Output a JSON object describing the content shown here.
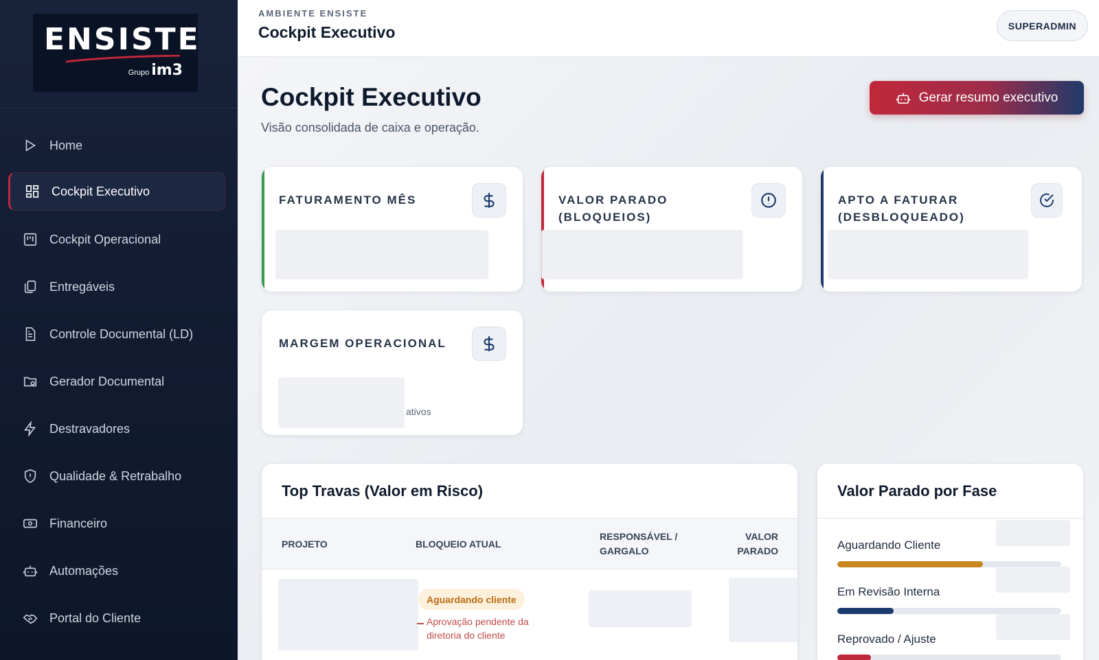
{
  "brand": {
    "name": "ENSISTE",
    "group_label": "Grupo",
    "group_name": "im3"
  },
  "sidebar": {
    "items": [
      {
        "label": "Home",
        "icon": "play-icon",
        "active": false
      },
      {
        "label": "Cockpit Executivo",
        "icon": "grid-icon",
        "active": true
      },
      {
        "label": "Cockpit Operacional",
        "icon": "kanban-icon",
        "active": false
      },
      {
        "label": "Entregáveis",
        "icon": "copy-icon",
        "active": false
      },
      {
        "label": "Controle Documental (LD)",
        "icon": "document-icon",
        "active": false
      },
      {
        "label": "Gerador Documental",
        "icon": "folder-gear-icon",
        "active": false
      },
      {
        "label": "Destravadores",
        "icon": "lightning-icon",
        "active": false
      },
      {
        "label": "Qualidade & Retrabalho",
        "icon": "shield-icon",
        "active": false
      },
      {
        "label": "Financeiro",
        "icon": "banknote-icon",
        "active": false
      },
      {
        "label": "Automações",
        "icon": "robot-icon",
        "active": false
      },
      {
        "label": "Portal do Cliente",
        "icon": "handshake-icon",
        "active": false
      }
    ]
  },
  "header": {
    "eyebrow": "AMBIENTE ENSISTE",
    "title": "Cockpit Executivo",
    "role": "SUPERADMIN"
  },
  "page": {
    "title": "Cockpit Executivo",
    "subtitle": "Visão consolidada de caixa e operação.",
    "action_label": "Gerar resumo executivo"
  },
  "kpis": [
    {
      "label": "FATURAMENTO MÊS",
      "icon": "dollar-icon",
      "accent": "#3a9a4f"
    },
    {
      "label": "VALOR PARADO (BLOQUEIOS)",
      "icon": "alert-circle-icon",
      "accent": "#c0283c"
    },
    {
      "label": "APTO A FATURAR (DESBLOQUEADO)",
      "icon": "check-circle-icon",
      "accent": "#1c3a6b"
    },
    {
      "label": "MARGEM OPERACIONAL",
      "icon": "dollar-icon",
      "accent": null,
      "tail_text": "ativos"
    }
  ],
  "travas": {
    "title": "Top Travas (Valor em Risco)",
    "columns": [
      "PROJETO",
      "BLOQUEIO ATUAL",
      "RESPONSÁVEL / GARGALO",
      "VALOR PARADO"
    ],
    "rows": [
      {
        "bloqueio": "Aguardando cliente",
        "nota": "Aprovação pendente da diretoria do cliente"
      }
    ]
  },
  "fases": {
    "title": "Valor Parado por Fase",
    "items": [
      {
        "label": "Aguardando Cliente",
        "share": 0.65,
        "color": "#c9861e"
      },
      {
        "label": "Em Revisão Interna",
        "share": 0.25,
        "color": "#1c3a6b"
      },
      {
        "label": "Reprovado / Ajuste",
        "share": 0.15,
        "color": "#c0283c"
      }
    ]
  }
}
